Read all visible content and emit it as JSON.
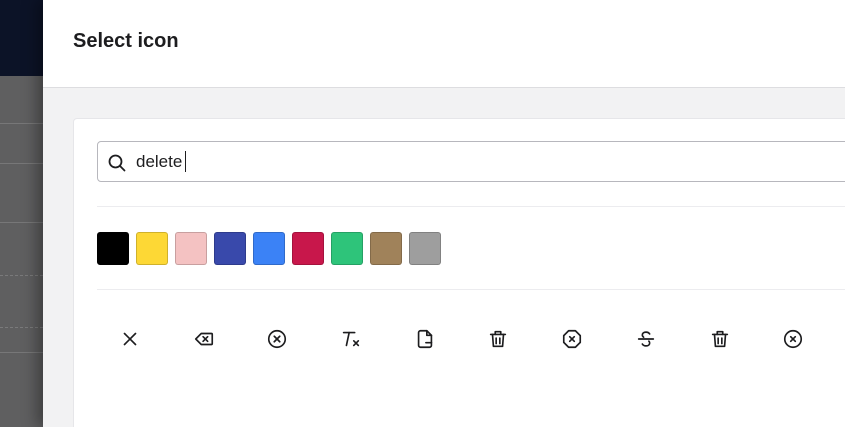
{
  "drawer": {
    "title": "Select icon"
  },
  "search": {
    "value": "delete",
    "placeholder": ""
  },
  "colors": [
    {
      "name": "black",
      "hex": "#000000"
    },
    {
      "name": "yellow",
      "hex": "#fdd835"
    },
    {
      "name": "pink",
      "hex": "#f4c2c2"
    },
    {
      "name": "indigo",
      "hex": "#3949ab"
    },
    {
      "name": "blue",
      "hex": "#3b82f6"
    },
    {
      "name": "crimson",
      "hex": "#c8174b"
    },
    {
      "name": "green",
      "hex": "#2ec47a"
    },
    {
      "name": "brown",
      "hex": "#a0825a"
    },
    {
      "name": "gray",
      "hex": "#9e9e9e"
    }
  ],
  "icons": [
    "x-icon",
    "backspace-icon",
    "circle-x-icon",
    "clear-formatting-icon",
    "file-minus-icon",
    "trash-icon",
    "octagon-x-icon",
    "strikethrough-icon",
    "trash-2-icon",
    "circle-x-outline-icon"
  ]
}
